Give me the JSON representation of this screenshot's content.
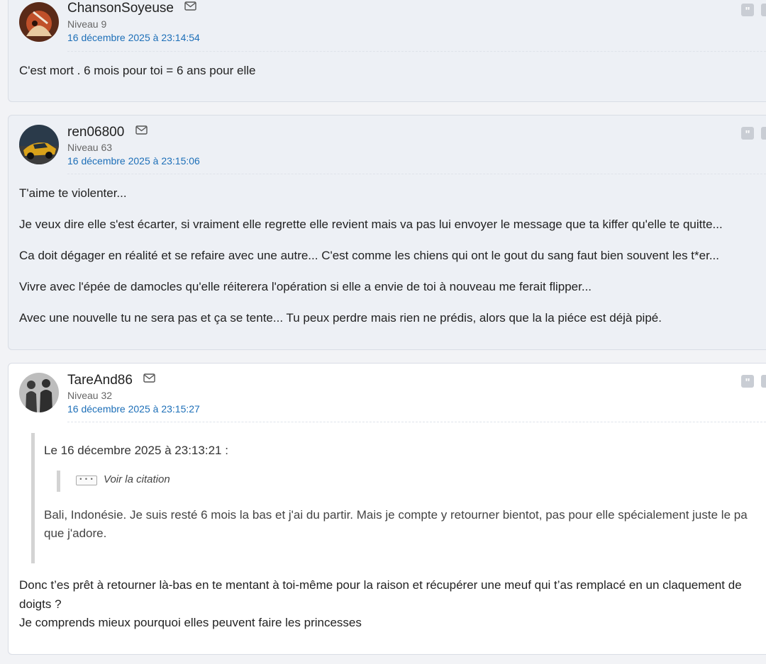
{
  "posts": [
    {
      "username": "ChansonSoyeuse",
      "level": "Niveau 9",
      "date": "16 décembre 2025 à 23:14:54",
      "body": [
        "C'est mort . 6 mois pour toi = 6 ans pour elle"
      ]
    },
    {
      "username": "ren06800",
      "level": "Niveau 63",
      "date": "16 décembre 2025 à 23:15:06",
      "body": [
        "T'aime te violenter...",
        "Je veux dire elle s'est écarter, si vraiment elle regrette elle revient mais va pas lui envoyer le message que ta kiffer qu'elle te quitte...",
        "Ca doit dégager en réalité et se refaire avec une autre... C'est comme les chiens qui ont le gout du sang faut bien souvent les t*er...",
        "Vivre avec l'épée de damocles qu'elle réiterera l'opération si elle a envie de toi à nouveau me ferait flipper...",
        "Avec une nouvelle tu ne sera pas et ça se tente... Tu peux perdre mais rien ne prédis, alors que la la piéce est déjà pipé."
      ]
    },
    {
      "username": "TareAnd86",
      "level": "Niveau 32",
      "date": "16 décembre 2025 à 23:15:27",
      "quote": {
        "header": "Le 16 décembre 2025 à 23:13:21 :",
        "ellipsis": "• • •",
        "voir": "Voir la citation",
        "lines": [
          "Bali, Indonésie. Je suis resté 6 mois la bas et j'ai du partir. Mais je compte y retourner bientot, pas pour elle spécialement juste le pa",
          "que j'adore."
        ]
      },
      "body": [
        "Donc t’es prêt à retourner là-bas en te mentant à toi-même pour la raison et récupérer une meuf qui t’as remplacé en un claquement de",
        "doigts ?",
        "Je comprends mieux pourquoi elles peuvent faire les princesses"
      ]
    }
  ],
  "quote_icon": "quote-icon",
  "mail_icon": "envelope-icon",
  "colors": {
    "date_link": "#1d6fb8",
    "shaded_bg": "#edf0f5",
    "page_bg": "#f2f3f6"
  }
}
